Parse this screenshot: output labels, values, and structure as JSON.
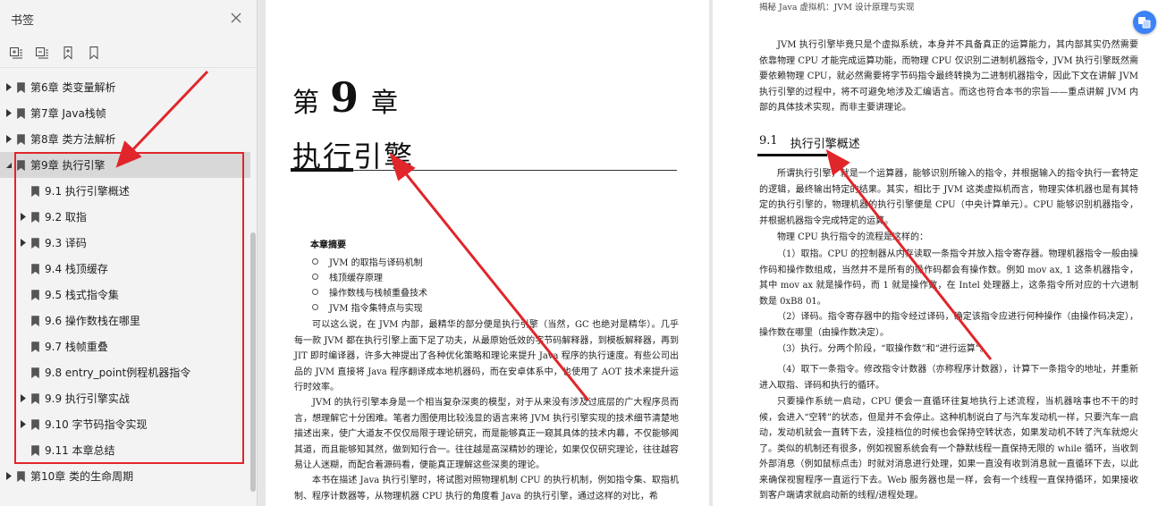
{
  "sidebar": {
    "title": "书签",
    "close_icon": "close-icon",
    "toolbar": [
      "expand-all-icon",
      "collapse-all-icon",
      "add-bookmark-icon",
      "bookmark-icon"
    ],
    "items": [
      {
        "label": "第6章 类变量解析",
        "level": 1,
        "expandable": true
      },
      {
        "label": "第7章 Java栈帧",
        "level": 1,
        "expandable": true
      },
      {
        "label": "第8章 类方法解析",
        "level": 1,
        "expandable": true
      },
      {
        "label": "第9章 执行引擎",
        "level": 1,
        "expandable": true,
        "expanded": true,
        "selected": true
      },
      {
        "label": "9.1 执行引擎概述",
        "level": 2,
        "expandable": false
      },
      {
        "label": "9.2 取指",
        "level": 2,
        "expandable": true
      },
      {
        "label": "9.3 译码",
        "level": 2,
        "expandable": true
      },
      {
        "label": "9.4 栈顶缓存",
        "level": 2,
        "expandable": false
      },
      {
        "label": "9.5 栈式指令集",
        "level": 2,
        "expandable": false
      },
      {
        "label": "9.6 操作数栈在哪里",
        "level": 2,
        "expandable": false
      },
      {
        "label": "9.7 栈帧重叠",
        "level": 2,
        "expandable": false
      },
      {
        "label": "9.8 entry_point例程机器指令",
        "level": 2,
        "expandable": false
      },
      {
        "label": "9.9 执行引擎实战",
        "level": 2,
        "expandable": true
      },
      {
        "label": "9.10 字节码指令实现",
        "level": 2,
        "expandable": true
      },
      {
        "label": "9.11 本章总结",
        "level": 2,
        "expandable": false
      },
      {
        "label": "第10章 类的生命周期",
        "level": 1,
        "expandable": true
      }
    ]
  },
  "left_page": {
    "chapter_prefix": "第",
    "chapter_number": "9",
    "chapter_suffix": "章",
    "chapter_title": "执行引擎",
    "summary_title": "本章摘要",
    "summary_items": [
      "JVM 的取指与译码机制",
      "栈顶缓存原理",
      "操作数栈与栈帧重叠技术",
      "JVM 指令集特点与实现"
    ],
    "paragraphs": [
      "可以这么说，在 JVM 内部，最精华的部分便是执行引擎（当然，GC 也绝对是精华）。几乎每一款 JVM 都在执行引擎上面下足了功夫，从最原始低效的字节码解释器，到模板解释器，再到 JIT 即时编译器，许多大神提出了各种优化策略和理论来提升 Java 程序的执行速度。有些公司出品的 JVM 直接将 Java 程序翻译成本地机器码，而在安卓体系中，也使用了 AOT 技术来提升运行时效率。",
      "JVM 的执行引擎本身是一个相当复杂深奥的模型，对于从来没有涉及过底层的广大程序员而言，想理解它十分困难。笔者力图使用比较浅显的语言来将 JVM 执行引擎实现的技术细节清楚地描述出来，使广大道友不仅仅局限于理论研究，而是能够真正一窥其具体的技术内幕，不仅能够闻其道，而且能够知其然，做到知行合一。往往越是高深精妙的理论，如果仅仅研究理论，往往越容易让人迷糊，而配合着源码看，便能真正理解这些深奥的理论。",
      "本书在描述 Java 执行引擎时，将试图对照物理机制 CPU 的执行机制，例如指令集、取指机制、程序计数器等，从物理机器 CPU 执行的角度看 Java 的执行引擎，通过这样的对比，希"
    ]
  },
  "right_page": {
    "running_header": "揭秘 Java 虚拟机：JVM 设计原理与实现",
    "para_intro": "JVM 执行引擎毕竟只是个虚拟系统，本身并不具备真正的运算能力，其内部其实仍然需要依靠物理 CPU 才能完成运算功能，而物理 CPU 仅识别二进制机器指令，JVM 执行引擎既然需要依赖物理 CPU，就必然需要将字节码指令最终转换为二进制机器指令，因此下文在讲解 JVM 执行引擎的过程中，将不可避免地涉及汇编语言。而这也符合本书的宗旨——重点讲解 JVM 内部的具体技术实现，而非主要讲理论。",
    "section_number": "9.1",
    "section_title": "执行引擎概述",
    "paragraphs": [
      "所谓执行引擎，就是一个运算器，能够识别所输入的指令，并根据输入的指令执行一套特定的逻辑，最终输出特定的结果。其实，相比于 JVM 这类虚拟机而言，物理实体机器也是有其特定的执行引擎的，物理机器的执行引擎便是 CPU（中央计算单元）。CPU 能够识别机器指令，并根据机器指令完成特定的运算。",
      "物理 CPU 执行指令的流程是这样的：",
      "（1）取指。CPU 的控制器从内存读取一条指令并放入指令寄存器。物理机器指令一般由操作码和操作数组成，当然并不是所有的操作码都会有操作数。例如 mov ax, 1 这条机器指令，其中 mov ax 就是操作码，而 1 就是操作数，在 Intel 处理器上，这条指令所对应的十六进制数是 0xB8 01。",
      "（2）译码。指令寄存器中的指令经过译码，确定该指令应进行何种操作（由操作码决定），操作数在哪里（由操作数决定）。",
      "（3）执行。分两个阶段，“取操作数”和“进行运算”。",
      "（4）取下一条指令。修改指令计数器（亦称程序计数器），计算下一条指令的地址，并重新进入取指、译码和执行的循环。",
      "只要操作系统一启动，CPU 便会一直循环往复地执行上述流程，当机器啥事也不干的时候，会进入“空转”的状态，但是并不会停止。这种机制说白了与汽车发动机一样，只要汽车一启动，发动机就会一直转下去，没挂档位的时候也会保持空转状态，如果发动机不转了汽车就熄火了。类似的机制还有很多，例如视窗系统会有一个静默线程一直保持无限的 while 循环，当收到外部消息（例如鼠标点击）时就对消息进行处理，如果一直没有收到消息就一直循环下去，以此来确保视窗程序一直运行下去。Web 服务器也是一样，会有一个线程一直保持循环，如果接收到客户端请求就启动新的线程/进程处理。"
    ]
  },
  "float_button_icon": "translate-icon",
  "colors": {
    "annotation_red": "#e0262b",
    "float_button": "#3b82f6",
    "selected_row": "#d8d8d8"
  }
}
